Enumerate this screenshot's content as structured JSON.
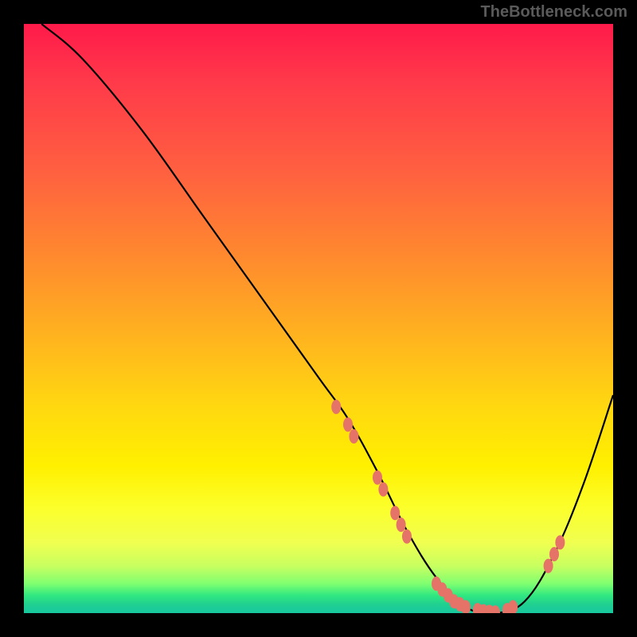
{
  "watermark": "TheBottleneck.com",
  "chart_data": {
    "type": "line",
    "title": "",
    "xlabel": "",
    "ylabel": "",
    "xlim": [
      0,
      100
    ],
    "ylim": [
      0,
      100
    ],
    "series": [
      {
        "name": "curve",
        "x": [
          3,
          10,
          20,
          30,
          40,
          50,
          55,
          60,
          65,
          70,
          75,
          80,
          85,
          90,
          95,
          100
        ],
        "y": [
          100,
          94,
          82,
          68,
          54,
          40,
          33,
          24,
          14,
          6,
          1,
          0,
          2,
          10,
          22,
          37
        ]
      }
    ],
    "markers": {
      "name": "highlight-points",
      "color": "#e57368",
      "points": [
        {
          "x": 53,
          "y": 35
        },
        {
          "x": 55,
          "y": 32
        },
        {
          "x": 56,
          "y": 30
        },
        {
          "x": 60,
          "y": 23
        },
        {
          "x": 61,
          "y": 21
        },
        {
          "x": 63,
          "y": 17
        },
        {
          "x": 64,
          "y": 15
        },
        {
          "x": 65,
          "y": 13
        },
        {
          "x": 70,
          "y": 5
        },
        {
          "x": 71,
          "y": 4
        },
        {
          "x": 72,
          "y": 3
        },
        {
          "x": 73,
          "y": 2
        },
        {
          "x": 74,
          "y": 1.5
        },
        {
          "x": 75,
          "y": 1
        },
        {
          "x": 77,
          "y": 0.5
        },
        {
          "x": 78,
          "y": 0.3
        },
        {
          "x": 79,
          "y": 0.2
        },
        {
          "x": 80,
          "y": 0.1
        },
        {
          "x": 82,
          "y": 0.5
        },
        {
          "x": 83,
          "y": 1
        },
        {
          "x": 89,
          "y": 8
        },
        {
          "x": 90,
          "y": 10
        },
        {
          "x": 91,
          "y": 12
        }
      ]
    }
  }
}
